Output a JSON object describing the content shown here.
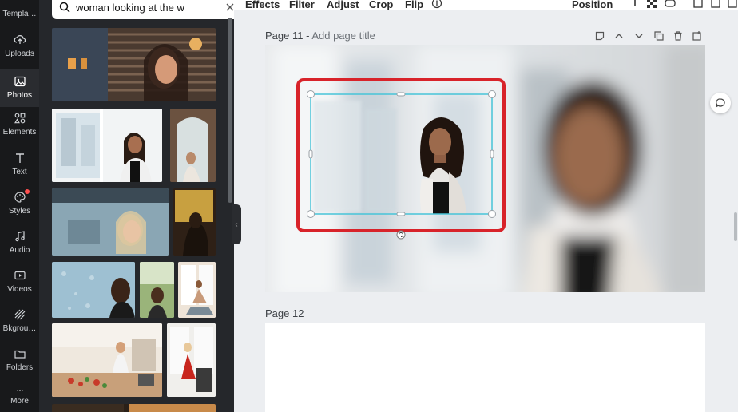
{
  "rail": {
    "items": [
      {
        "label": "Templa…",
        "icon": "templates-icon"
      },
      {
        "label": "Uploads",
        "icon": "upload-cloud-icon"
      },
      {
        "label": "Photos",
        "icon": "image-icon"
      },
      {
        "label": "Elements",
        "icon": "shapes-icon"
      },
      {
        "label": "Text",
        "icon": "text-icon"
      },
      {
        "label": "Styles",
        "icon": "palette-icon"
      },
      {
        "label": "Audio",
        "icon": "music-note-icon"
      },
      {
        "label": "Videos",
        "icon": "video-icon"
      },
      {
        "label": "Bkgrou…",
        "icon": "background-icon"
      },
      {
        "label": "Folders",
        "icon": "folder-icon"
      },
      {
        "label": "More",
        "icon": "more-dots-icon"
      }
    ],
    "active": "Photos"
  },
  "search": {
    "value": "woman looking at the w"
  },
  "toolbar": {
    "effects": "Effects",
    "filter": "Filter",
    "adjust": "Adjust",
    "crop": "Crop",
    "flip": "Flip",
    "position": "Position"
  },
  "pages": {
    "page11_label": "Page 11 -",
    "page11_placeholder": "Add page title",
    "page12_label": "Page 12"
  },
  "colors": {
    "rail_bg": "#18191b",
    "panel_bg": "#25272b",
    "selection": "#47c4d8",
    "highlight": "#d8232a"
  }
}
